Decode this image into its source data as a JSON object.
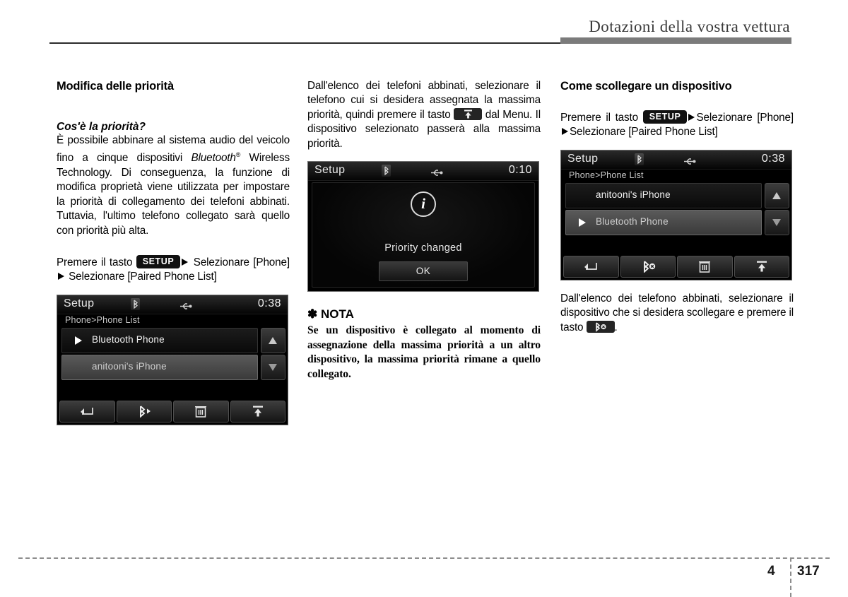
{
  "header": {
    "title": "Dotazioni della vostra vettura"
  },
  "footer": {
    "chapter": "4",
    "page": "317"
  },
  "column1": {
    "section_title": "Modifica delle priorità",
    "sub_title": "Cos'è la priorità?",
    "paragraph_part1": "È possibile abbinare al sistema audio del veicolo fino a cinque dispositivi ",
    "paragraph_bluetooth": "Bluetooth",
    "paragraph_registered": "®",
    "paragraph_part2": " Wireless Technology. Di conseguenza, la funzione di modifica proprietà viene utilizzata per impostare la priorità di collegamento dei telefoni abbinati. Tuttavia, l'ultimo telefono collegato sarà quello con priorità più alta.",
    "instruction_pre": "Premere il tasto ",
    "setup_label": "SETUP",
    "instruction_post": " Selezionare [Phone]",
    "instruction_post2": " Selezionare [Paired Phone List]",
    "screen": {
      "title": "Setup",
      "clock": "0:38",
      "breadcrumb": "Phone>Phone List",
      "rows": [
        {
          "label": "Bluetooth Phone",
          "style": "dark",
          "marker": true
        },
        {
          "label": "anitooni's iPhone",
          "style": "light",
          "marker": false
        }
      ],
      "toolbar": [
        {
          "icon": "back-arrow-icon"
        },
        {
          "icon": "bluetooth-connect-icon"
        },
        {
          "icon": "trash-icon"
        },
        {
          "icon": "priority-top-icon"
        }
      ]
    }
  },
  "column2": {
    "paragraph_pre": "Dall'elenco dei telefoni abbinati, selezionare il telefono cui si desidera assegnata la massima priorità, quindi premere il tasto ",
    "paragraph_post": " dal Menu. Il dispositivo selezionato passerà alla massima priorità.",
    "screen": {
      "title": "Setup",
      "clock": "0:10",
      "info_glyph": "i",
      "message": "Priority changed",
      "ok_label": "OK"
    },
    "note": {
      "star": "✽",
      "heading": "NOTA",
      "body": "Se un dispositivo è collegato al momento di assegnazione della massima priorità a un altro dispositivo, la massima priorità rimane a quello collegato."
    }
  },
  "column3": {
    "section_title": "Come scollegare un dispositivo",
    "instruction_pre": "Premere il tasto ",
    "setup_label": "SETUP",
    "instruction_post": "Selezionare [Phone]",
    "instruction_post2": "Selezionare [Paired Phone List]",
    "screen": {
      "title": "Setup",
      "clock": "0:38",
      "breadcrumb": "Phone>Phone List",
      "rows": [
        {
          "label": "anitooni's iPhone",
          "style": "dark",
          "marker": false
        },
        {
          "label": "Bluetooth Phone",
          "style": "light",
          "marker": true
        }
      ],
      "toolbar": [
        {
          "icon": "back-arrow-icon"
        },
        {
          "icon": "bluetooth-disconnect-icon"
        },
        {
          "icon": "trash-icon"
        },
        {
          "icon": "priority-top-icon"
        }
      ]
    },
    "paragraph_pre": "Dall'elenco dei telefono abbinati, selezionare il dispositivo che si desidera scollegare e premere il tasto ",
    "paragraph_post": "."
  },
  "colors": {
    "header_rule_thin": "#2b2b2b",
    "header_rule_thick": "#7b7b7b",
    "screen_bg": "#000000",
    "chip_bg": "#111111"
  }
}
